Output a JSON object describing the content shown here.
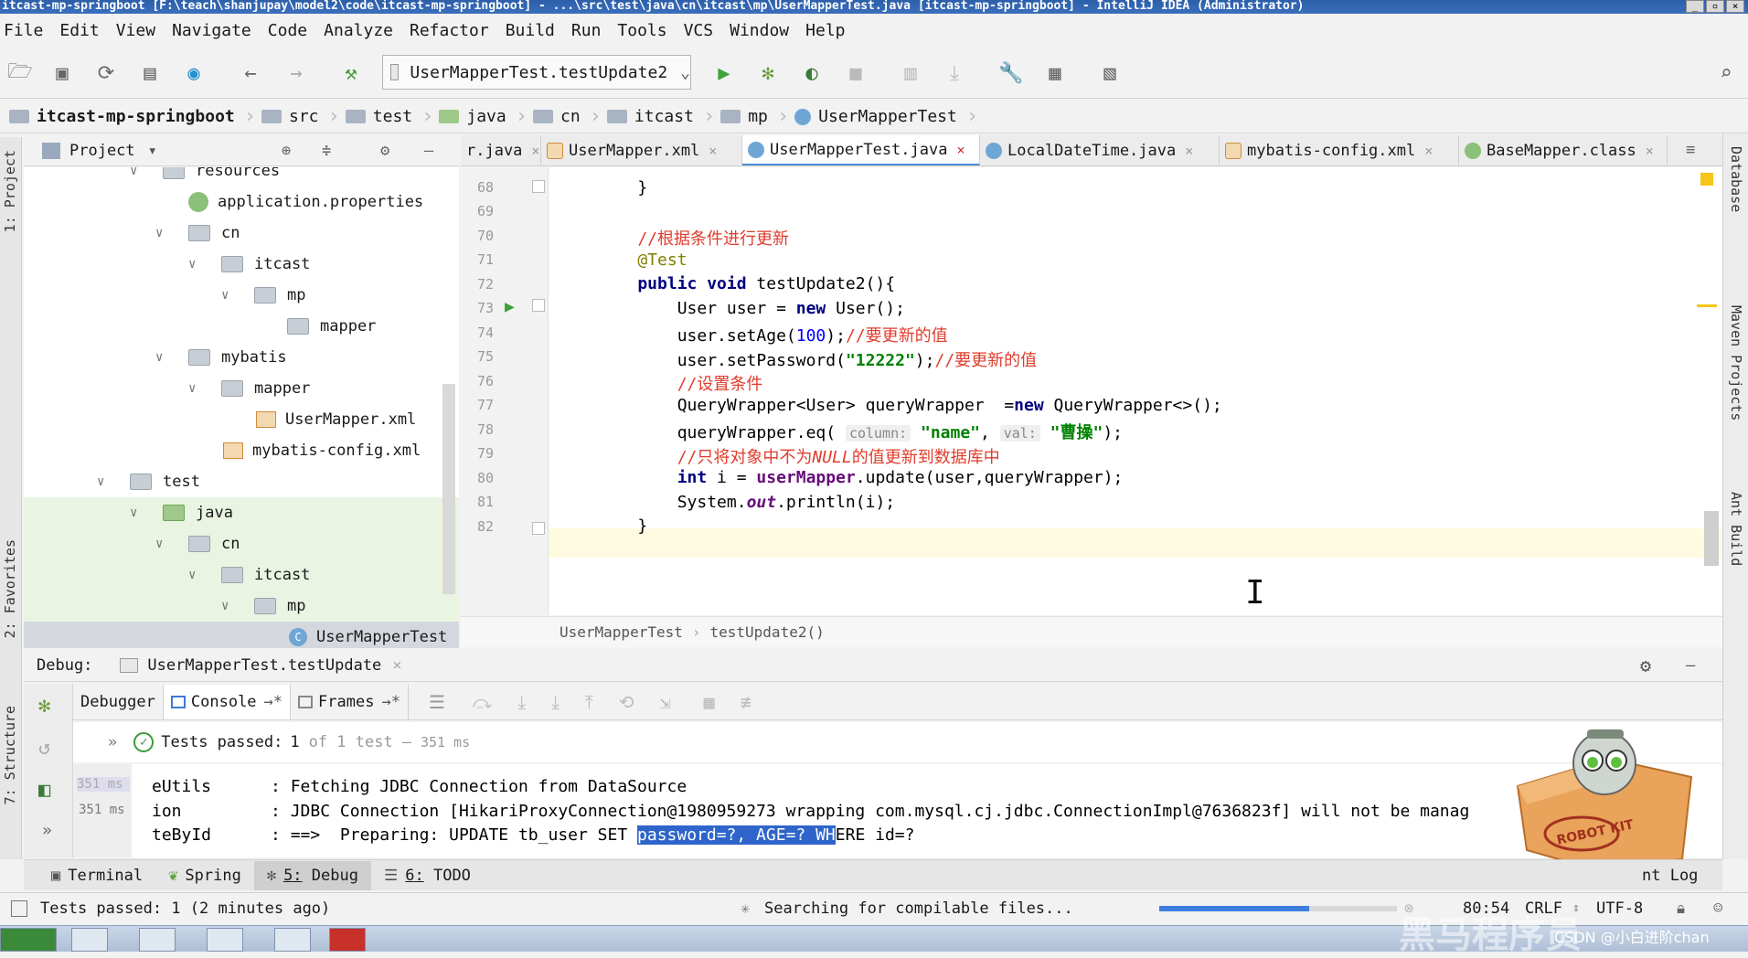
{
  "window": {
    "title": "itcast-mp-springboot [F:\\teach\\shanjupay\\model2\\code\\itcast-mp-springboot] - ...\\src\\test\\java\\cn\\itcast\\mp\\UserMapperTest.java [itcast-mp-springboot] - IntelliJ IDEA (Administrator)"
  },
  "menu": [
    "File",
    "Edit",
    "View",
    "Navigate",
    "Code",
    "Analyze",
    "Refactor",
    "Build",
    "Run",
    "Tools",
    "VCS",
    "Window",
    "Help"
  ],
  "toolbar": {
    "run_config": "UserMapperTest.testUpdate2"
  },
  "breadcrumb": [
    "itcast-mp-springboot",
    "src",
    "test",
    "java",
    "cn",
    "itcast",
    "mp",
    "UserMapperTest"
  ],
  "project": {
    "header": "Project",
    "tree": [
      {
        "label": "resources",
        "kind": "folder"
      },
      {
        "label": "application.properties",
        "kind": "props"
      },
      {
        "label": "cn",
        "kind": "folder"
      },
      {
        "label": "itcast",
        "kind": "folder"
      },
      {
        "label": "mp",
        "kind": "folder"
      },
      {
        "label": "mapper",
        "kind": "folder"
      },
      {
        "label": "mybatis",
        "kind": "folder"
      },
      {
        "label": "mapper",
        "kind": "folder"
      },
      {
        "label": "UserMapper.xml",
        "kind": "xml"
      },
      {
        "label": "mybatis-config.xml",
        "kind": "xml"
      },
      {
        "label": "test",
        "kind": "folder"
      },
      {
        "label": "java",
        "kind": "folder-green"
      },
      {
        "label": "cn",
        "kind": "folder"
      },
      {
        "label": "itcast",
        "kind": "folder"
      },
      {
        "label": "mp",
        "kind": "folder"
      },
      {
        "label": "UserMapperTest",
        "kind": "class"
      }
    ]
  },
  "tabs": [
    {
      "label": "r.java"
    },
    {
      "label": "UserMapper.xml"
    },
    {
      "label": "UserMapperTest.java",
      "active": true
    },
    {
      "label": "LocalDateTime.java"
    },
    {
      "label": "mybatis-config.xml"
    },
    {
      "label": "BaseMapper.class"
    }
  ],
  "editor": {
    "line_numbers": [
      "68",
      "69",
      "70",
      "71",
      "72",
      "73",
      "74",
      "75",
      "76",
      "77",
      "78",
      "79",
      "80",
      "81",
      "82"
    ],
    "code": {
      "l68": "    }",
      "l70": "    //根据条件进行更新",
      "l71": "    @Test",
      "l72_kw": "    public void ",
      "l72_rest": "testUpdate2(){",
      "l73a": "        User user = ",
      "l73kw": "new",
      "l73b": " User();",
      "l74a": "        user.setAge(",
      "l74n": "100",
      "l74b": ");",
      "l74c": "//要更新的值",
      "l75a": "        user.setPassword(",
      "l75s": "\"12222\"",
      "l75b": ");",
      "l75c": "//要更新的值",
      "l76": "        //设置条件",
      "l77a": "        QueryWrapper<User> queryWrapper  =",
      "l77kw": "new",
      "l77b": " QueryWrapper<>();",
      "l78a": "        queryWrapper.eq( ",
      "l78h1": "column:",
      "l78s1": " \"name\"",
      "l78b": ", ",
      "l78h2": "val:",
      "l78s2": " \"曹操\"",
      "l78c": ");",
      "l79a": "        //只将对象中不为",
      "l79i": "NULL",
      "l79b": "的值更新到数据库中",
      "l80kw": "        int",
      "l80a": " i = ",
      "l80f": "userMapper",
      "l80b": ".update(user,queryWrapper);",
      "l81a": "        System.",
      "l81i": "out",
      "l81b": ".println(i);",
      "l82": "    }"
    },
    "crumb": [
      "UserMapperTest",
      "testUpdate2()"
    ]
  },
  "debug": {
    "label": "Debug:",
    "session": "UserMapperTest.testUpdate",
    "tabs": [
      "Debugger",
      "Console",
      "Frames"
    ],
    "tests_passed_label": "Tests passed:",
    "tests_count": "1",
    "tests_of": "of 1 test",
    "tests_dash": "–",
    "tests_time": "351 ms",
    "console_times": [
      "351 ms",
      "351 ms"
    ],
    "console_lines": [
      {
        "a": "eUtils      : Fetching JDBC Connection from DataSource"
      },
      {
        "a": "ion         : JDBC Connection [HikariProxyConnection@1980959273 wrapping com.mysql.cj.jdbc.ConnectionImpl@7636823f] will not be manag"
      },
      {
        "a": "teById      : ==>  Preparing: UPDATE tb_user SET ",
        "sel": "password=?, AGE=? WH",
        "b": "ERE id=?"
      }
    ]
  },
  "bottom_tabs": [
    {
      "num": "",
      "label": "Terminal"
    },
    {
      "num": "",
      "label": "Spring"
    },
    {
      "num": "5:",
      "label": "Debug",
      "active": true
    },
    {
      "num": "6:",
      "label": "TODO"
    }
  ],
  "event_log": "nt Log",
  "status": {
    "message": "Tests passed: 1 (2 minutes ago)",
    "searching": "Searching for compilable files...",
    "progress_fraction": 0.63,
    "position": "80:54",
    "line_sep": "CRLF",
    "encoding": "UTF-8"
  },
  "side": {
    "left_project": "1: Project",
    "left_favorites": "2: Favorites",
    "left_structure": "7: Structure",
    "right_database": "Database",
    "right_maven": "Maven Projects",
    "right_ant": "Ant Build"
  },
  "overlay": {
    "robot_label": "ROBOT KIT",
    "watermark": "黑马程序员",
    "csdn": "CSDN @小白进阶chan"
  }
}
